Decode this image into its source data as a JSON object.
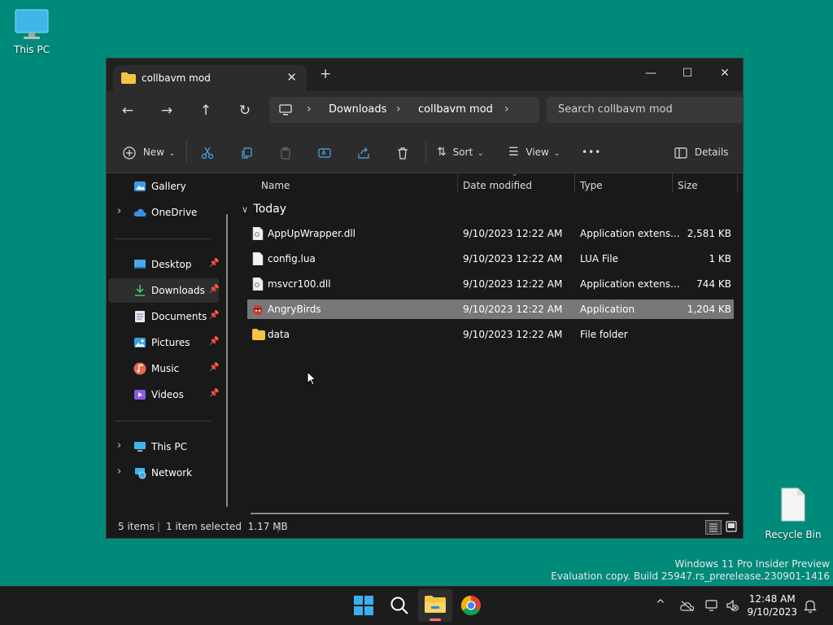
{
  "desktop": {
    "this_pc_label": "This PC",
    "recycle_bin_label": "Recycle Bin"
  },
  "window": {
    "tab_title": "collbavm mod",
    "tab_close": "✕",
    "new_tab": "+",
    "minimize": "—",
    "maximize": "☐",
    "close": "✕"
  },
  "navbar": {
    "breadcrumbs": [
      "Downloads",
      "collbavm mod"
    ],
    "search_placeholder": "Search collbavm mod"
  },
  "commandbar": {
    "new_label": "New",
    "sort_label": "Sort",
    "view_label": "View",
    "more_label": "•••",
    "details_label": "Details"
  },
  "sidebar": {
    "items": [
      {
        "label": "Gallery"
      },
      {
        "label": "OneDrive"
      },
      {
        "label": "Desktop"
      },
      {
        "label": "Downloads"
      },
      {
        "label": "Documents"
      },
      {
        "label": "Pictures"
      },
      {
        "label": "Music"
      },
      {
        "label": "Videos"
      },
      {
        "label": "This PC"
      },
      {
        "label": "Network"
      }
    ]
  },
  "columns": {
    "name": "Name",
    "date": "Date modified",
    "type": "Type",
    "size": "Size"
  },
  "group_label": "Today",
  "files": [
    {
      "name": "AppUpWrapper.dll",
      "date": "9/10/2023 12:22 AM",
      "type": "Application extens...",
      "size": "2,581 KB"
    },
    {
      "name": "config.lua",
      "date": "9/10/2023 12:22 AM",
      "type": "LUA File",
      "size": "1 KB"
    },
    {
      "name": "msvcr100.dll",
      "date": "9/10/2023 12:22 AM",
      "type": "Application extens...",
      "size": "744 KB"
    },
    {
      "name": "AngryBirds",
      "date": "9/10/2023 12:22 AM",
      "type": "Application",
      "size": "1,204 KB"
    },
    {
      "name": "data",
      "date": "9/10/2023 12:22 AM",
      "type": "File folder",
      "size": ""
    }
  ],
  "status": {
    "count": "5 items",
    "selection": "1 item selected  1.17 MB"
  },
  "watermark": {
    "line1": "Windows 11 Pro Insider Preview",
    "line2": "Evaluation copy. Build 25947.rs_prerelease.230901-1416"
  },
  "clock": {
    "time": "12:48 AM",
    "date": "9/10/2023"
  }
}
